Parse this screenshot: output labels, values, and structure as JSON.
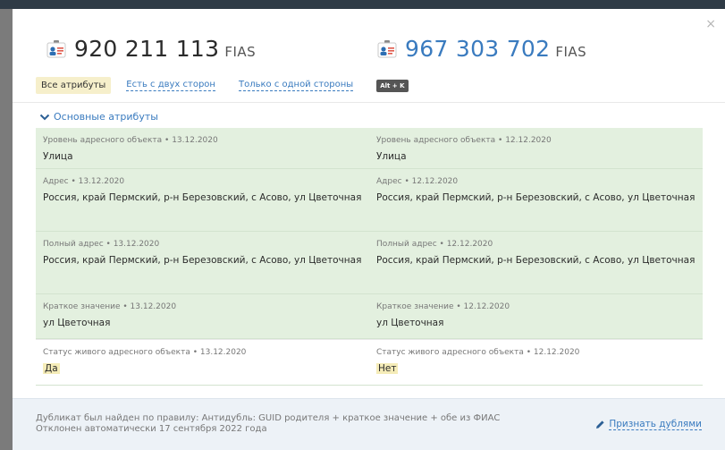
{
  "left": {
    "id": "920 211 113",
    "source": "FIAS"
  },
  "right": {
    "id": "967 303 702",
    "source": "FIAS"
  },
  "filters": {
    "all": "Все атрибуты",
    "both": "Есть с двух сторон",
    "one": "Только с одной стороны",
    "shortcut": "Alt + K"
  },
  "section": {
    "title": "Основные атрибуты"
  },
  "rows": [
    {
      "left_label": "Уровень адресного объекта • 13.12.2020",
      "left_value": "Улица",
      "right_label": "Уровень адресного объекта • 12.12.2020",
      "right_value": "Улица"
    },
    {
      "left_label": "Адрес • 13.12.2020",
      "left_value": "Россия, край Пермский, р-н Березовский, с Асово, ул Цветочная",
      "right_label": "Адрес • 12.12.2020",
      "right_value": "Россия, край Пермский, р-н Березовский, с Асово, ул Цветочная"
    },
    {
      "left_label": "Полный адрес • 13.12.2020",
      "left_value": "Россия, край Пермский, р-н Березовский, с Асово, ул Цветочная",
      "right_label": "Полный адрес • 12.12.2020",
      "right_value": "Россия, край Пермский, р-н Березовский, с Асово, ул Цветочная"
    },
    {
      "left_label": "Краткое значение • 13.12.2020",
      "left_value": "ул Цветочная",
      "right_label": "Краткое значение • 12.12.2020",
      "right_value": "ул Цветочная"
    },
    {
      "left_label": "Статус живого адресного объекта • 13.12.2020",
      "left_value": "Да",
      "right_label": "Статус живого адресного объекта • 12.12.2020",
      "right_value": "Нет"
    }
  ],
  "footer": {
    "line1": "Дубликат был найден по правилу: Антидубль: GUID родителя + краткое значение + обе из ФИАС",
    "line2": "Отклонен автоматически 17 сентября 2022 года",
    "action": "Признать дублями"
  },
  "colors": {
    "accent": "#3a7bbf",
    "diff_bg": "#e3f0df",
    "highlight": "#f5ecb8"
  },
  "icons": {
    "record": "id-card-icon",
    "collapse": "chevron-down-icon",
    "action": "pencil-icon",
    "close": "close-icon"
  }
}
